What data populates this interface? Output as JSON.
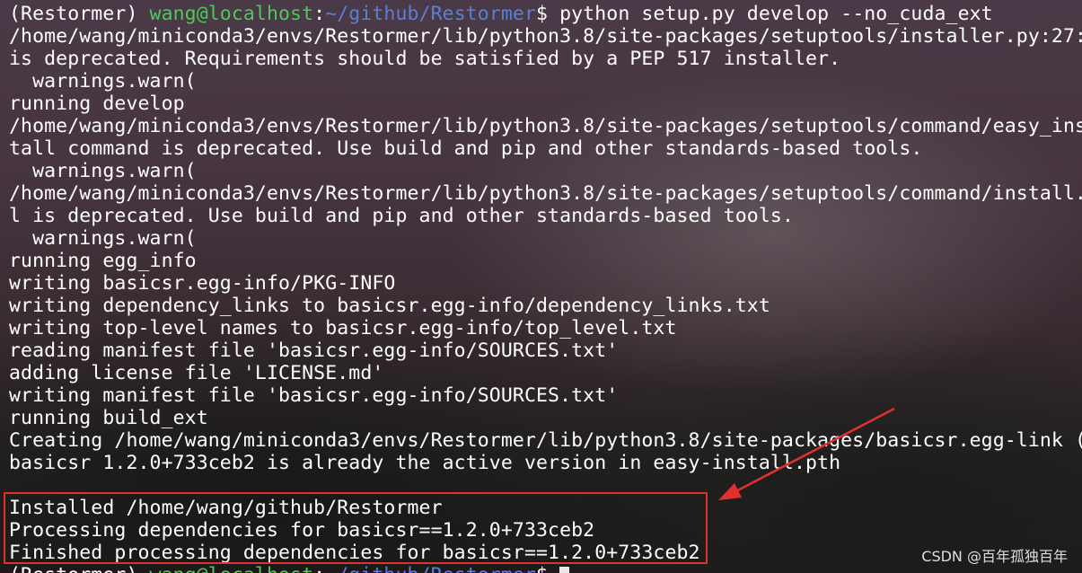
{
  "terminal": {
    "prompt_top": {
      "env": "(Restormer) ",
      "user_host": "wang@localhost",
      "colon": ":",
      "path": "~/github/Restormer",
      "symbol": "$ ",
      "command": "python setup.py develop --no_cuda_ext"
    },
    "output_lines": [
      "/home/wang/miniconda3/envs/Restormer/lib/python3.8/site-packages/setuptools/installer.py:27:",
      "is deprecated. Requirements should be satisfied by a PEP 517 installer.",
      "  warnings.warn(",
      "running develop",
      "/home/wang/miniconda3/envs/Restormer/lib/python3.8/site-packages/setuptools/command/easy_ins",
      "tall command is deprecated. Use build and pip and other standards-based tools.",
      "  warnings.warn(",
      "/home/wang/miniconda3/envs/Restormer/lib/python3.8/site-packages/setuptools/command/install.",
      "l is deprecated. Use build and pip and other standards-based tools.",
      "  warnings.warn(",
      "running egg_info",
      "writing basicsr.egg-info/PKG-INFO",
      "writing dependency_links to basicsr.egg-info/dependency_links.txt",
      "writing top-level names to basicsr.egg-info/top_level.txt",
      "reading manifest file 'basicsr.egg-info/SOURCES.txt'",
      "adding license file 'LICENSE.md'",
      "writing manifest file 'basicsr.egg-info/SOURCES.txt'",
      "running build_ext",
      "Creating /home/wang/miniconda3/envs/Restormer/lib/python3.8/site-packages/basicsr.egg-link (",
      "basicsr 1.2.0+733ceb2 is already the active version in easy-install.pth",
      "",
      "Installed /home/wang/github/Restormer",
      "Processing dependencies for basicsr==1.2.0+733ceb2",
      "Finished processing dependencies for basicsr==1.2.0+733ceb2"
    ],
    "prompt_bottom": {
      "env": "(Restormer) ",
      "user_host": "wang@localhost",
      "colon": ":",
      "path": "~/github/Restormer",
      "symbol": "$ "
    }
  },
  "annotations": {
    "highlight_color": "#e03030"
  },
  "watermark": "CSDN @百年孤独百年"
}
